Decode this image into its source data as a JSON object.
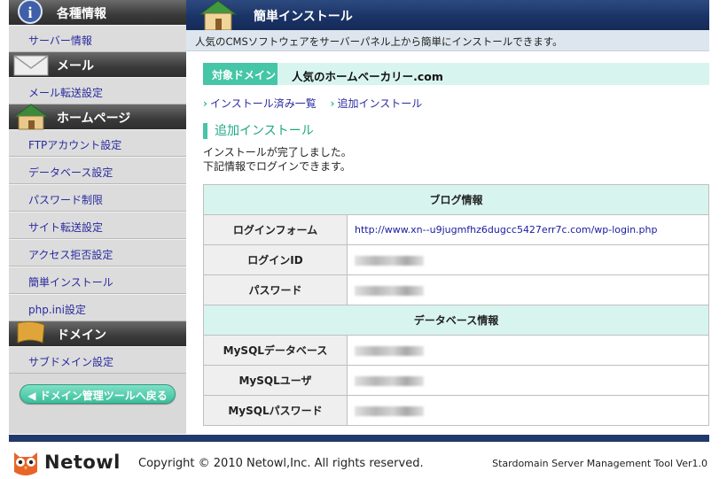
{
  "header": {
    "title": "簡単インストール",
    "subtitle": "人気のCMSソフトウェアをサーバーパネル上から簡単にインストールできます。"
  },
  "sidebar": {
    "sections": [
      {
        "title": "各種情報",
        "icon": "info-icon",
        "items": [
          "サーバー情報"
        ]
      },
      {
        "title": "メール",
        "icon": "envelope-icon",
        "items": [
          "メール転送設定"
        ]
      },
      {
        "title": "ホームページ",
        "icon": "house-icon",
        "items": [
          "FTPアカウント設定",
          "データベース設定",
          "パスワード制限",
          "サイト転送設定",
          "アクセス拒否設定",
          "簡単インストール",
          "php.ini設定"
        ]
      },
      {
        "title": "ドメイン",
        "icon": "flag-icon",
        "items": [
          "サブドメイン設定"
        ]
      }
    ],
    "back_button": "◀ ドメイン管理ツールへ戻る"
  },
  "main": {
    "domain_label": "対象ドメイン",
    "domain_value": "人気のホームベーカリー.com",
    "links": [
      "インストール済み一覧",
      "追加インストール"
    ],
    "section_title": "追加インストール",
    "messages": [
      "インストールが完了しました。",
      "下記情報でログインできます。"
    ],
    "blog_info_header": "ブログ情報",
    "blog_rows": [
      {
        "key": "ログインフォーム",
        "value": "http://www.xn--u9jugmfhz6dugcc5427err7c.com/wp-login.php"
      },
      {
        "key": "ログインID",
        "value": ""
      },
      {
        "key": "パスワード",
        "value": ""
      }
    ],
    "db_info_header": "データベース情報",
    "db_rows": [
      {
        "key": "MySQLデータベース",
        "value": ""
      },
      {
        "key": "MySQLユーザ",
        "value": ""
      },
      {
        "key": "MySQLパスワード",
        "value": ""
      }
    ]
  },
  "footer": {
    "logo": "Netowl",
    "copyright": "Copyright © 2010 Netowl,Inc. All rights reserved.",
    "tool_name": "Stardomain Server Management Tool Ver1.0"
  },
  "colors": {
    "accent": "#45c6a6",
    "header": "#1b3466",
    "link": "#2a2aa0"
  }
}
